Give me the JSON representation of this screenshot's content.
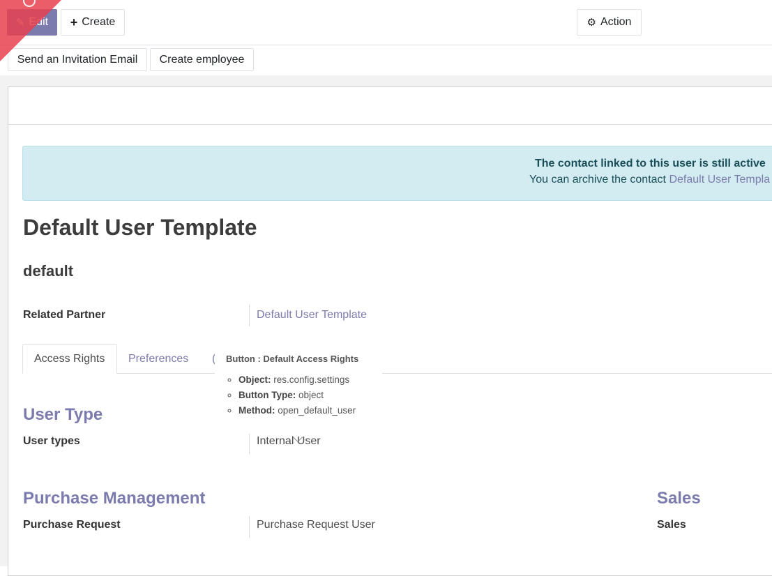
{
  "toolbar": {
    "edit_label": "Edit",
    "create_label": "Create",
    "action_label": "Action",
    "send_invite_label": "Send an Invitation Email",
    "create_employee_label": "Create employee"
  },
  "alert": {
    "title": "The contact linked to this user is still active",
    "text": "You can archive the contact",
    "link": "Default User Templa"
  },
  "record": {
    "name": "Default User Template",
    "login": "default",
    "related_partner_label": "Related Partner",
    "related_partner_value": "Default User Template"
  },
  "tabs": [
    {
      "label": "Access Rights"
    },
    {
      "label": "Preferences"
    },
    {
      "label": "("
    }
  ],
  "tooltip": {
    "title": "Button : Default Access Rights",
    "items": [
      {
        "key": "Object:",
        "value": "res.config.settings"
      },
      {
        "key": "Button Type:",
        "value": "object"
      },
      {
        "key": "Method:",
        "value": "open_default_user"
      }
    ]
  },
  "sections": {
    "user_type": {
      "title": "User Type",
      "field_label": "User types",
      "field_value": "Internal User"
    },
    "purchase": {
      "title": "Purchase Management",
      "field_label": "Purchase Request",
      "field_value": "Purchase Request User"
    },
    "sales": {
      "title": "Sales",
      "field_label": "Sales"
    }
  },
  "colors": {
    "primary": "#7c7bad",
    "alert_bg": "#d2ecf1",
    "ribbon": "#e8414e"
  }
}
